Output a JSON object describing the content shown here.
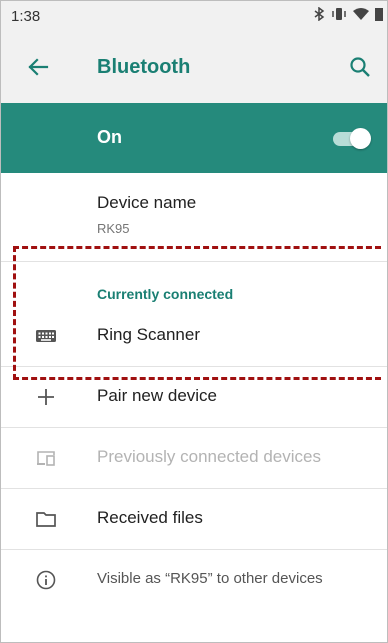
{
  "status": {
    "time": "1:38"
  },
  "appbar": {
    "title": "Bluetooth"
  },
  "toggle": {
    "label": "On",
    "state": "on",
    "accent": "#258a7c"
  },
  "device_name": {
    "title": "Device name",
    "value": "RK95"
  },
  "connected": {
    "section_title": "Currently connected",
    "devices": [
      {
        "name": "Ring Scanner",
        "icon": "keyboard-icon"
      }
    ]
  },
  "actions": {
    "pair": "Pair new device",
    "previous": "Previously connected devices",
    "received": "Received files",
    "visible": "Visible as “RK95” to other devices"
  }
}
